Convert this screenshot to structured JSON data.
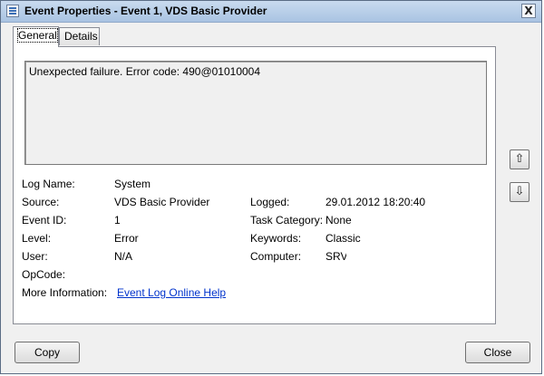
{
  "window": {
    "title": "Event Properties - Event 1, VDS Basic Provider",
    "close_glyph": "X"
  },
  "tabs": [
    {
      "label": "General",
      "selected": true
    },
    {
      "label": "Details",
      "selected": false
    }
  ],
  "message": "Unexpected failure. Error code: 490@01010004",
  "fields": {
    "log_name": {
      "label": "Log Name:",
      "value": "System"
    },
    "source": {
      "label": "Source:",
      "value": "VDS Basic Provider"
    },
    "event_id": {
      "label": "Event ID:",
      "value": "1"
    },
    "level": {
      "label": "Level:",
      "value": "Error"
    },
    "user": {
      "label": "User:",
      "value": "N/A"
    },
    "opcode": {
      "label": "OpCode:",
      "value": ""
    },
    "more_info": {
      "label": "More Information:",
      "value": "Event Log Online Help"
    },
    "logged": {
      "label": "Logged:",
      "value": "29.01.2012 18:20:40"
    },
    "task_category": {
      "label": "Task Category:",
      "value": "None"
    },
    "keywords": {
      "label": "Keywords:",
      "value": "Classic"
    },
    "computer": {
      "label": "Computer:",
      "value": "SRV-"
    }
  },
  "nav": {
    "up_icon": "arrow-up-icon",
    "down_icon": "arrow-down-icon",
    "up_glyph": "⇧",
    "down_glyph": "⇩"
  },
  "buttons": {
    "copy": "Copy",
    "close": "Close"
  }
}
